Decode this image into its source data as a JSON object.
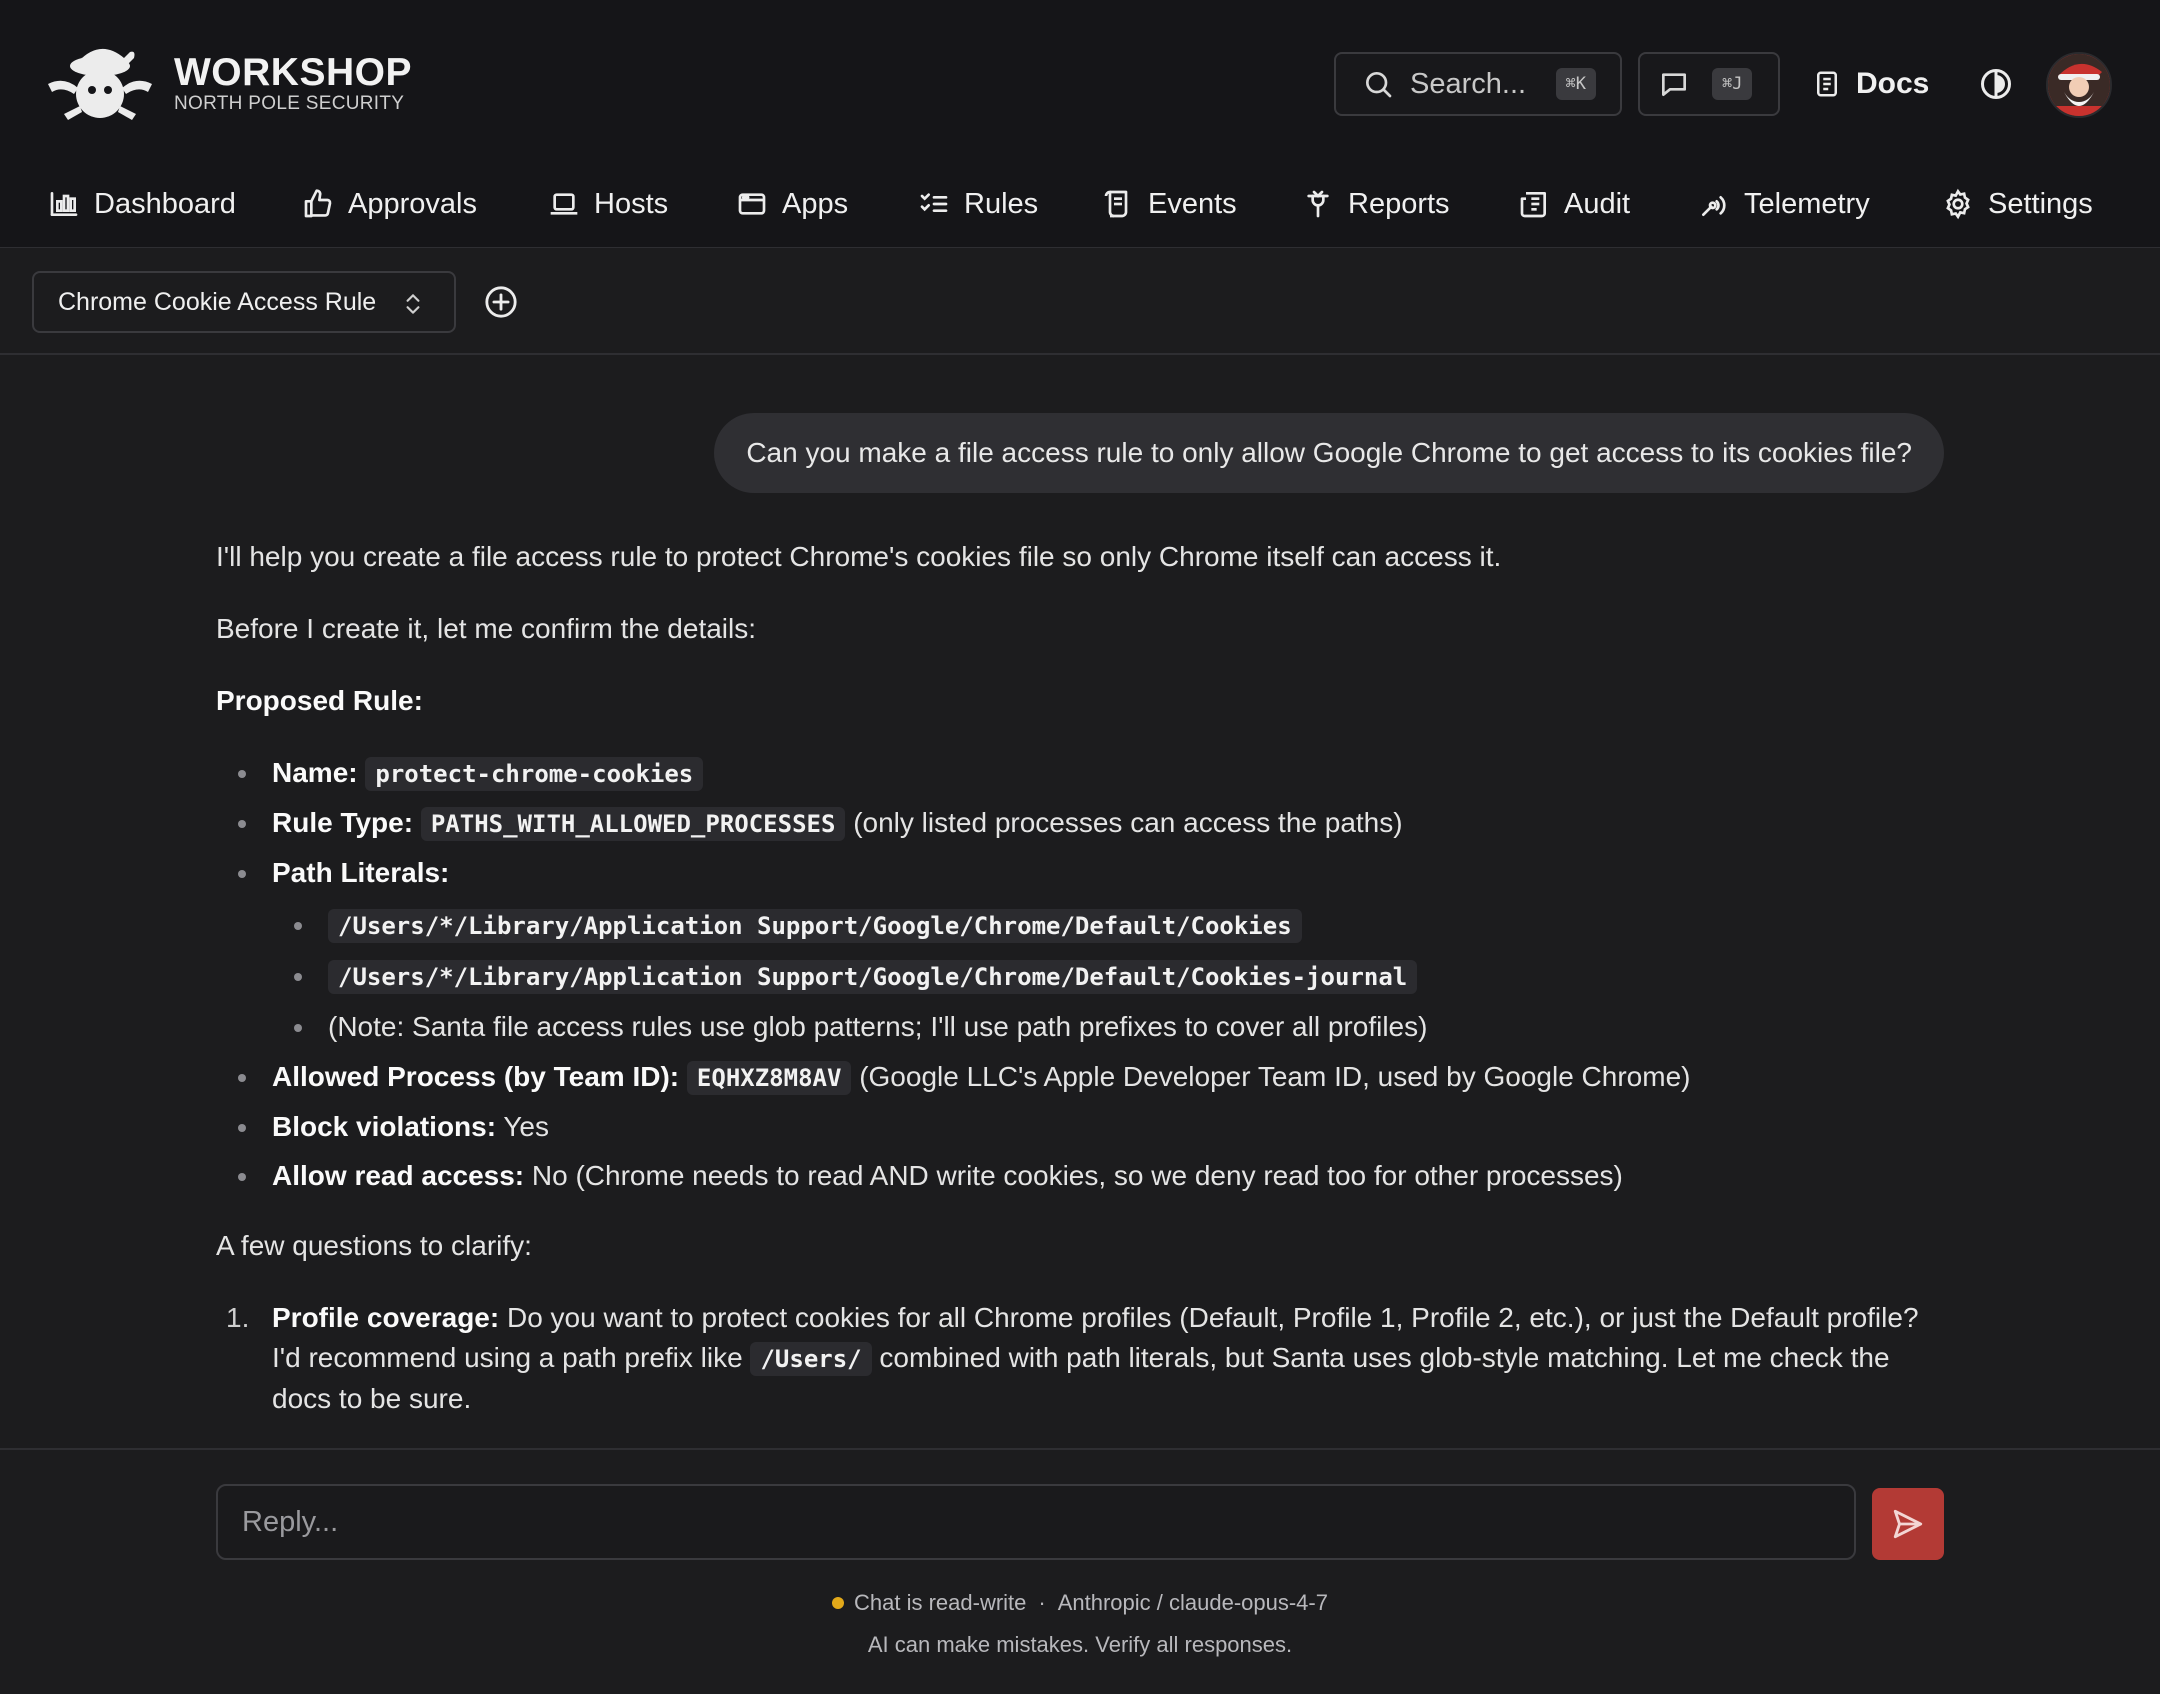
{
  "brand": {
    "title": "WORKSHOP",
    "subtitle": "NORTH POLE SECURITY"
  },
  "header": {
    "search_placeholder": "Search...",
    "search_shortcut": "⌘K",
    "chat_shortcut": "⌘J",
    "docs_label": "Docs"
  },
  "nav": {
    "items": [
      {
        "label": "Dashboard",
        "icon": "bar-chart-icon"
      },
      {
        "label": "Approvals",
        "icon": "thumbs-up-icon"
      },
      {
        "label": "Hosts",
        "icon": "laptop-icon"
      },
      {
        "label": "Apps",
        "icon": "app-window-icon"
      },
      {
        "label": "Rules",
        "icon": "list-checks-icon"
      },
      {
        "label": "Events",
        "icon": "scroll-icon"
      },
      {
        "label": "Reports",
        "icon": "reports-icon"
      },
      {
        "label": "Audit",
        "icon": "newspaper-icon"
      },
      {
        "label": "Telemetry",
        "icon": "radio-icon"
      },
      {
        "label": "Settings",
        "icon": "gear-icon"
      }
    ]
  },
  "conversation": {
    "title": "Chrome Cookie Access Rule"
  },
  "user_message": "Can you make a file access rule to only allow Google Chrome to get access to its cookies file?",
  "assistant": {
    "intro": "I'll help you create a file access rule to protect Chrome's cookies file so only Chrome itself can access it.",
    "confirm": "Before I create it, let me confirm the details:",
    "proposed_heading": "Proposed Rule:",
    "name_label": "Name:",
    "name_value": "protect-chrome-cookies",
    "type_label": "Rule Type:",
    "type_value": "PATHS_WITH_ALLOWED_PROCESSES",
    "type_note": "(only listed processes can access the paths)",
    "paths_label": "Path Literals:",
    "path_1": "/Users/*/Library/Application Support/Google/Chrome/Default/Cookies",
    "path_2": "/Users/*/Library/Application Support/Google/Chrome/Default/Cookies-journal",
    "path_note": "(Note: Santa file access rules use glob patterns; I'll use path prefixes to cover all profiles)",
    "allowed_label": "Allowed Process (by Team ID):",
    "allowed_value": "EQHXZ8M8AV",
    "allowed_note": "(Google LLC's Apple Developer Team ID, used by Google Chrome)",
    "block_label": "Block violations:",
    "block_value": "Yes",
    "read_label": "Allow read access:",
    "read_value": "No (Chrome needs to read AND write cookies, so we deny read too for other processes)",
    "questions_heading": "A few questions to clarify:",
    "q1_num": "1.",
    "q1_label": "Profile coverage:",
    "q1_text_a": "Do you want to protect cookies for all Chrome profiles (Default, Profile 1, Profile 2, etc.), or just the Default profile? I'd recommend using a path prefix like",
    "q1_code": "/Users/",
    "q1_text_b": "combined with path literals, but Santa uses glob-style matching. Let me check the docs to be sure."
  },
  "composer": {
    "placeholder": "Reply...",
    "status": "Chat is read-write",
    "separator": "·",
    "model": "Anthropic / claude-opus-4-7",
    "disclaimer": "AI can make mistakes. Verify all responses."
  },
  "colors": {
    "accent": "#b33a35",
    "status_dot": "#e2a91a",
    "background": "#1c1c1e"
  }
}
